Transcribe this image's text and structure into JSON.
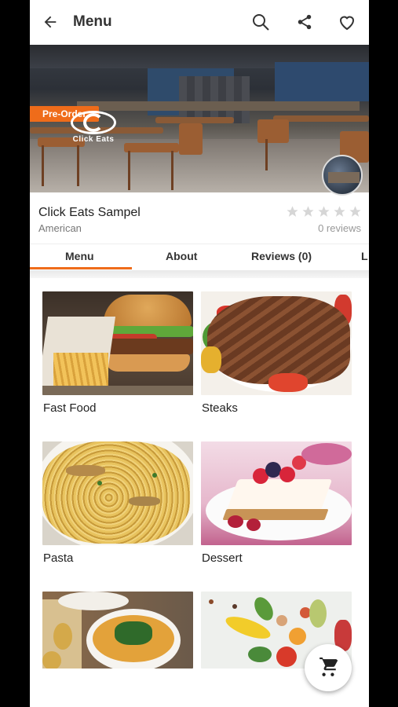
{
  "appbar": {
    "title": "Menu"
  },
  "hero": {
    "badge": "Pre-Order",
    "logo_text": "Click Eats"
  },
  "restaurant": {
    "name": "Click Eats Sampel",
    "cuisine": "American",
    "rating": 0,
    "rating_max": 5,
    "reviews": "0 reviews"
  },
  "tabs": [
    {
      "label": "Menu",
      "active": true
    },
    {
      "label": "About",
      "active": false
    },
    {
      "label": "Reviews (0)",
      "active": false
    },
    {
      "label": "L",
      "active": false
    }
  ],
  "categories": [
    {
      "label": "Fast Food"
    },
    {
      "label": "Steaks"
    },
    {
      "label": "Pasta"
    },
    {
      "label": "Dessert"
    },
    {
      "label": ""
    },
    {
      "label": ""
    }
  ],
  "colors": {
    "accent": "#ef6c1a",
    "text": "#222222",
    "muted": "#777777"
  },
  "icons": {
    "back": "arrow-left-icon",
    "search": "search-icon",
    "share": "share-icon",
    "favorite": "heart-icon",
    "cart": "cart-icon"
  }
}
